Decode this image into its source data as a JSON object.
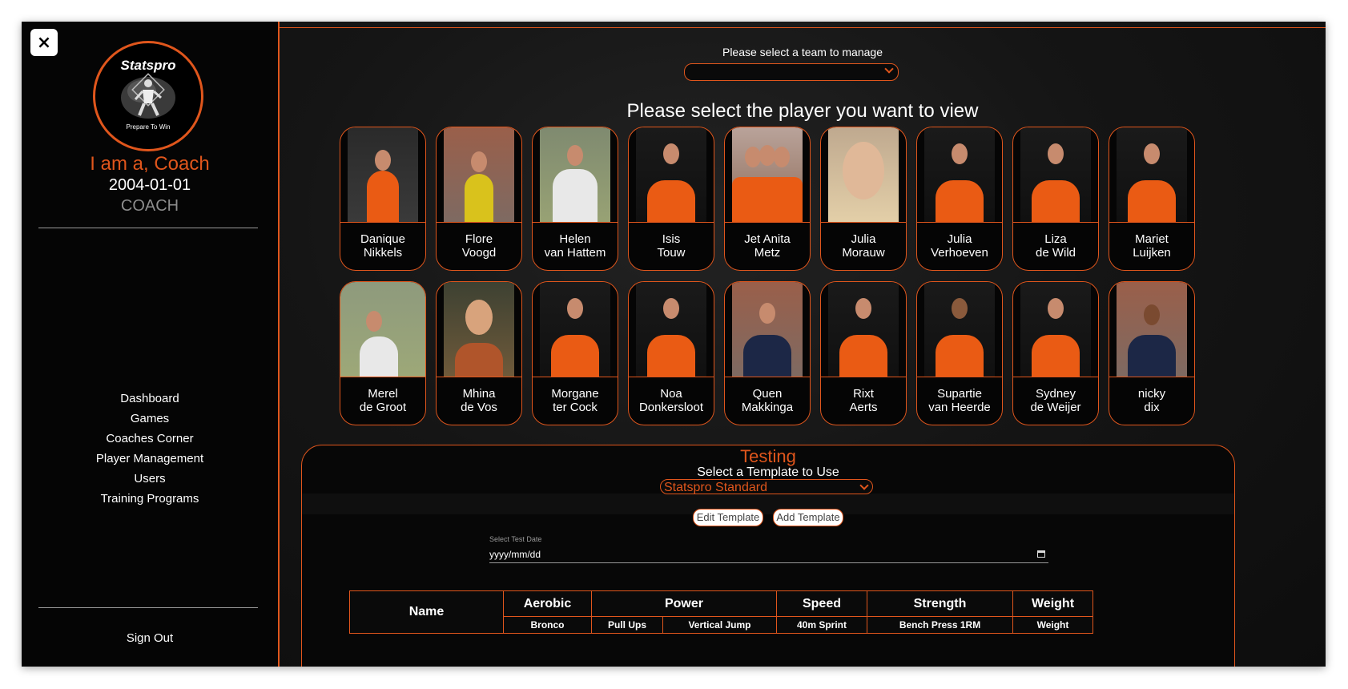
{
  "sidebar": {
    "close_label": "×",
    "logo": {
      "title": "Statspro",
      "tagline": "Prepare To Win"
    },
    "role_title": "I am a, Coach",
    "dob": "2004-01-01",
    "role_label": "COACH",
    "nav": [
      "Dashboard",
      "Games",
      "Coaches Corner",
      "Player Management",
      "Users",
      "Training Programs"
    ],
    "sign_out": "Sign Out"
  },
  "main": {
    "team_label": "Please select a team to manage",
    "team_value": "",
    "player_heading": "Please select the player you want to view",
    "players": [
      {
        "first": "Danique",
        "last": "Nikkels"
      },
      {
        "first": "Flore",
        "last": "Voogd"
      },
      {
        "first": "Helen",
        "last": "van Hattem"
      },
      {
        "first": "Isis",
        "last": "Touw"
      },
      {
        "first": "Jet Anita",
        "last": "Metz"
      },
      {
        "first": "Julia",
        "last": "Morauw"
      },
      {
        "first": "Julia",
        "last": "Verhoeven"
      },
      {
        "first": "Liza",
        "last": "de Wild"
      },
      {
        "first": "Mariet",
        "last": "Luijken"
      },
      {
        "first": "Merel",
        "last": "de Groot"
      },
      {
        "first": "Mhina",
        "last": "de Vos"
      },
      {
        "first": "Morgane",
        "last": "ter Cock"
      },
      {
        "first": "Noa",
        "last": "Donkersloot"
      },
      {
        "first": "Quen",
        "last": "Makkinga"
      },
      {
        "first": "Rixt",
        "last": "Aerts"
      },
      {
        "first": "Supartie",
        "last": "van Heerde"
      },
      {
        "first": "Sydney",
        "last": "de Weijer"
      },
      {
        "first": "nicky",
        "last": "dix"
      }
    ]
  },
  "testing": {
    "title": "Testing",
    "template_label": "Select a Template to Use",
    "template_value": "Statspro Standard",
    "edit_template": "Edit Template",
    "add_template": "Add Template",
    "date_label": "Select Test Date",
    "date_placeholder": "yyyy/mm/dd",
    "table": {
      "name_header": "Name",
      "groups": [
        "Aerobic",
        "Power",
        "Speed",
        "Strength",
        "Weight"
      ],
      "sub_headers": [
        "Bronco",
        "Pull Ups",
        "Vertical Jump",
        "40m Sprint",
        "Bench Press 1RM",
        "Weight"
      ]
    }
  },
  "colors": {
    "accent": "#e0561c",
    "background": "#0b0b0b"
  }
}
